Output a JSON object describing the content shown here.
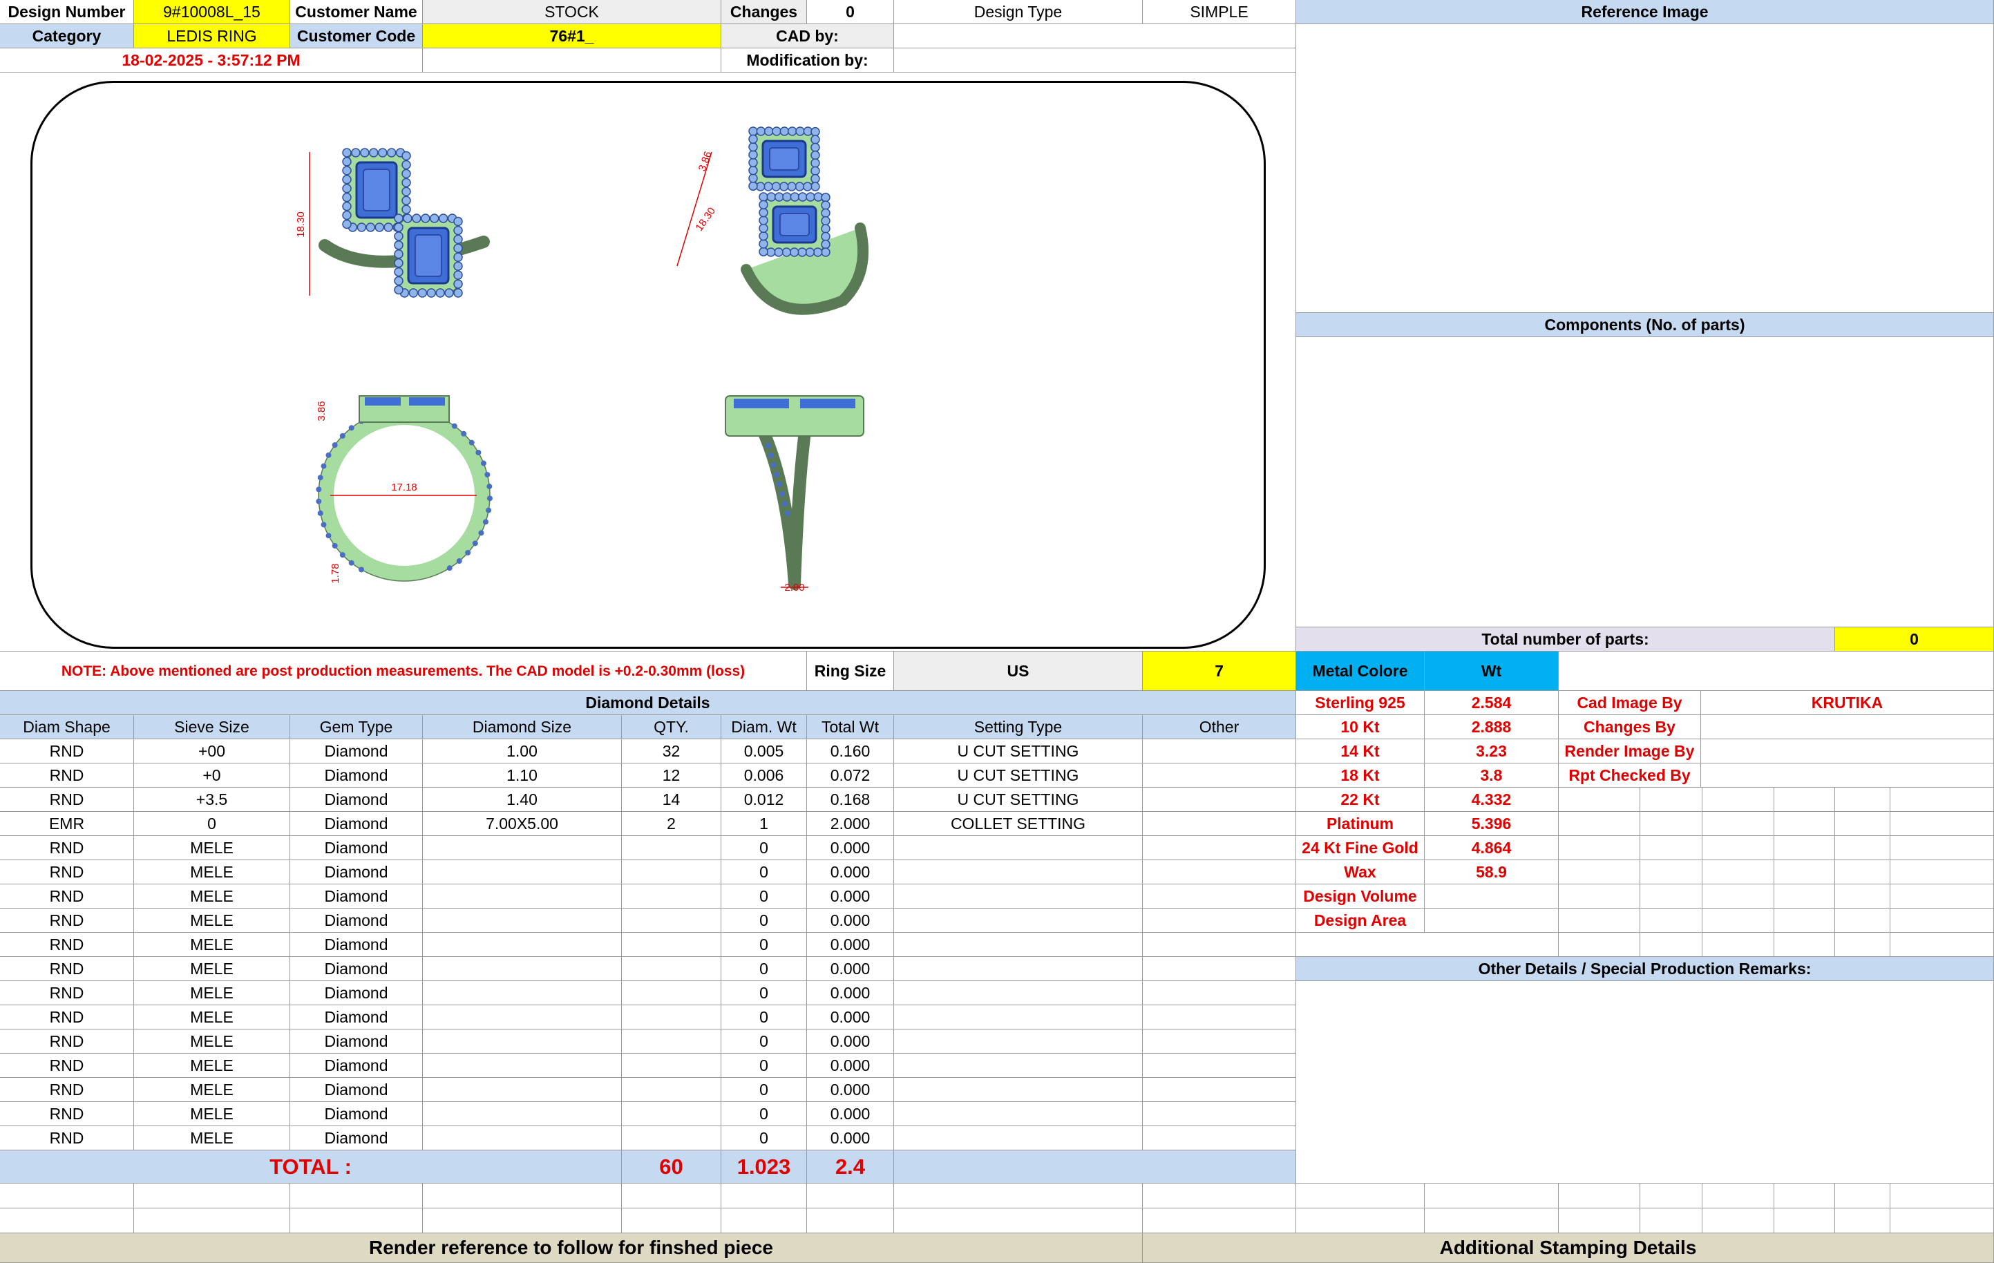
{
  "header": {
    "design_number_label": "Design Number",
    "design_number": "9#10008L_15",
    "customer_name_label": "Customer Name",
    "customer_name": "STOCK",
    "changes_label": "Changes",
    "changes": "0",
    "design_type_label": "Design Type",
    "design_type": "SIMPLE",
    "reference_image_label": "Reference Image",
    "category_label": "Category",
    "category": "LEDIS RING",
    "customer_code_label": "Customer Code",
    "customer_code": "76#1_",
    "cad_by_label": "CAD by:",
    "cad_by": "",
    "datetime": "18-02-2025 - 3:57:12 PM",
    "modification_by_label": "Modification by:",
    "modification_by": ""
  },
  "drawing": {
    "dims": {
      "top_height": "18.30",
      "persp_a": "3.86",
      "persp_b": "18.30",
      "side_a": "3.86",
      "inner_dia": "17.18",
      "band_w": "1.78",
      "shank_w": "2.00"
    }
  },
  "components": {
    "label": "Components (No. of parts)",
    "total_label": "Total number of parts:",
    "total": "0"
  },
  "note": {
    "text": "NOTE: Above mentioned are post production measurements. The CAD model is +0.2-0.30mm (loss)",
    "ring_size_label": "Ring Size",
    "ring_size_system": "US",
    "ring_size": "7"
  },
  "metal": {
    "col_name": "Metal Colore",
    "col_wt": "Wt",
    "rows": [
      {
        "name": "Sterling 925",
        "wt": "2.584"
      },
      {
        "name": "10 Kt",
        "wt": "2.888"
      },
      {
        "name": "14 Kt",
        "wt": "3.23"
      },
      {
        "name": "18 Kt",
        "wt": "3.8"
      },
      {
        "name": "22 Kt",
        "wt": "4.332"
      },
      {
        "name": "Platinum",
        "wt": "5.396"
      },
      {
        "name": "24 Kt Fine Gold",
        "wt": "4.864"
      },
      {
        "name": "Wax",
        "wt": "58.9"
      },
      {
        "name": "Design Volume",
        "wt": ""
      },
      {
        "name": "Design Area",
        "wt": ""
      }
    ]
  },
  "people": [
    {
      "label": "Cad Image By",
      "value": "KRUTIKA"
    },
    {
      "label": "Changes By",
      "value": ""
    },
    {
      "label": "Render Image By",
      "value": ""
    },
    {
      "label": "Rpt Checked By",
      "value": ""
    }
  ],
  "other_details_label": "Other Details / Special Production Remarks:",
  "diamonds": {
    "title": "Diamond Details",
    "columns": [
      "Diam Shape",
      "Sieve Size",
      "Gem Type",
      "Diamond Size",
      "QTY.",
      "Diam. Wt",
      "Total Wt",
      "Setting Type",
      "Other"
    ],
    "rows": [
      [
        "RND",
        "+00",
        "Diamond",
        "1.00",
        "32",
        "0.005",
        "0.160",
        "U CUT SETTING",
        ""
      ],
      [
        "RND",
        "+0",
        "Diamond",
        "1.10",
        "12",
        "0.006",
        "0.072",
        "U CUT SETTING",
        ""
      ],
      [
        "RND",
        "+3.5",
        "Diamond",
        "1.40",
        "14",
        "0.012",
        "0.168",
        "U CUT SETTING",
        ""
      ],
      [
        "EMR",
        "0",
        "Diamond",
        "7.00X5.00",
        "2",
        "1",
        "2.000",
        "COLLET SETTING",
        ""
      ],
      [
        "RND",
        "MELE",
        "Diamond",
        "",
        "",
        "0",
        "0.000",
        "",
        ""
      ],
      [
        "RND",
        "MELE",
        "Diamond",
        "",
        "",
        "0",
        "0.000",
        "",
        ""
      ],
      [
        "RND",
        "MELE",
        "Diamond",
        "",
        "",
        "0",
        "0.000",
        "",
        ""
      ],
      [
        "RND",
        "MELE",
        "Diamond",
        "",
        "",
        "0",
        "0.000",
        "",
        ""
      ],
      [
        "RND",
        "MELE",
        "Diamond",
        "",
        "",
        "0",
        "0.000",
        "",
        ""
      ],
      [
        "RND",
        "MELE",
        "Diamond",
        "",
        "",
        "0",
        "0.000",
        "",
        ""
      ],
      [
        "RND",
        "MELE",
        "Diamond",
        "",
        "",
        "0",
        "0.000",
        "",
        ""
      ],
      [
        "RND",
        "MELE",
        "Diamond",
        "",
        "",
        "0",
        "0.000",
        "",
        ""
      ],
      [
        "RND",
        "MELE",
        "Diamond",
        "",
        "",
        "0",
        "0.000",
        "",
        ""
      ],
      [
        "RND",
        "MELE",
        "Diamond",
        "",
        "",
        "0",
        "0.000",
        "",
        ""
      ],
      [
        "RND",
        "MELE",
        "Diamond",
        "",
        "",
        "0",
        "0.000",
        "",
        ""
      ],
      [
        "RND",
        "MELE",
        "Diamond",
        "",
        "",
        "0",
        "0.000",
        "",
        ""
      ],
      [
        "RND",
        "MELE",
        "Diamond",
        "",
        "",
        "0",
        "0.000",
        "",
        ""
      ]
    ],
    "total_label": "TOTAL :",
    "total_qty": "60",
    "total_diam_wt": "1.023",
    "total_wt": "2.4"
  },
  "footer": {
    "render_reference": "Render reference to follow for finshed piece",
    "stamping": "Additional Stamping Details"
  },
  "colors": {
    "yellow": "#ffff00",
    "light_blue": "#c5d9f1",
    "cyan_blue": "#00b0f0",
    "red_text": "#e00000",
    "ring_green": "#a6dca0",
    "stone_blue": "#3f6fd6",
    "footer_tan": "#ddd9c3"
  }
}
